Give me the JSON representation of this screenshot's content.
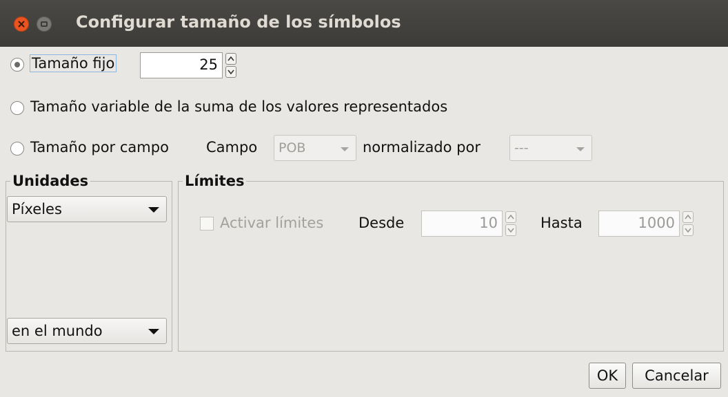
{
  "window": {
    "title": "Configurar tamaño de los símbolos"
  },
  "size_mode": {
    "fixed": {
      "label": "Tamaño fijo",
      "value": "25",
      "selected": true
    },
    "variable": {
      "label": "Tamaño variable de la suma de los valores representados",
      "selected": false
    },
    "by_field": {
      "label": "Tamaño por campo",
      "field_label": "Campo",
      "field_value": "POB",
      "normalized_label": "normalizado por",
      "normalized_value": "---",
      "selected": false
    }
  },
  "units": {
    "legend": "Unidades",
    "unit_value": "Píxeles",
    "scope_value": "en el mundo"
  },
  "limits": {
    "legend": "Límites",
    "activate_label": "Activar límites",
    "activated": false,
    "from_label": "Desde",
    "from_value": "10",
    "to_label": "Hasta",
    "to_value": "1000"
  },
  "buttons": {
    "ok": "OK",
    "cancel": "Cancelar"
  }
}
